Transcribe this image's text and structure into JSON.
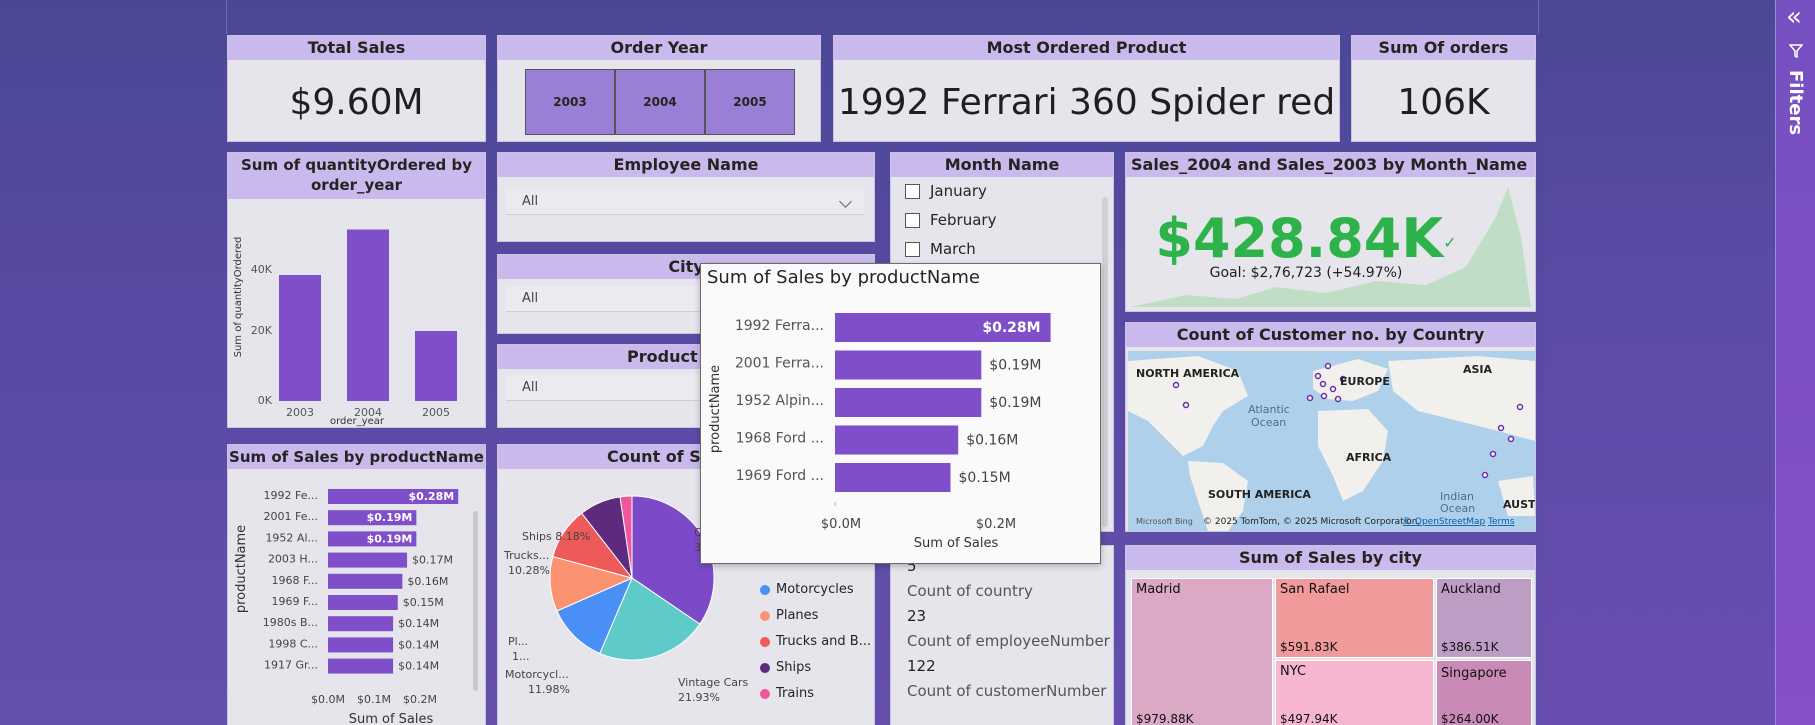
{
  "colors": {
    "bar": "#7f4fc9",
    "accent": "#2db34a",
    "header": "#c9b9ec",
    "tile": "#e6e5ec"
  },
  "kpis": {
    "total_sales": {
      "title": "Total Sales",
      "value": "$9.60M"
    },
    "order_year": {
      "title": "Order Year",
      "years": [
        "2003",
        "2004",
        "2005"
      ]
    },
    "most_ordered": {
      "title": "Most Ordered Product",
      "value": "1992 Ferrari 360 Spider red"
    },
    "sum_orders": {
      "title": "Sum Of orders",
      "value": "106K"
    }
  },
  "qty_chart": {
    "title": "Sum of quantityOrdered by order_year",
    "ylabel": "Sum of quantityOrdered",
    "xlabel": "order_year",
    "yticks": [
      "40K",
      "20K",
      "0K"
    ],
    "chart_data": {
      "type": "bar",
      "categories": [
        "2003",
        "2004",
        "2005"
      ],
      "values": [
        36000,
        49000,
        20000
      ],
      "ylim": [
        0,
        50000
      ],
      "xlabel": "order_year",
      "ylabel": "Sum of quantityOrdered"
    }
  },
  "employee_slicer": {
    "title": "Employee Name",
    "value": "All"
  },
  "city_slicer": {
    "title": "City",
    "value": "All"
  },
  "product_slicer": {
    "title": "Product Type",
    "value": "All"
  },
  "month_slicer": {
    "title": "Month Name",
    "items": [
      "January",
      "February",
      "March"
    ]
  },
  "gauge": {
    "title": "Sales_2004 and Sales_2003 by Month_Name",
    "value": "$428.84K",
    "check": "✓",
    "goal": "Goal: $2,76,723 (+54.97%)"
  },
  "map": {
    "title": "Count of Customer no. by Country",
    "labels": [
      "NORTH AMERICA",
      "EUROPE",
      "ASIA",
      "Atlantic",
      "Ocean",
      "AFRICA",
      "SOUTH AMERICA",
      "Indian",
      "Ocean",
      "AUST"
    ],
    "attribution": "© 2025 TomTom, © 2025 Microsoft Corporation,",
    "osm": "© OpenStreetMap",
    "terms": "Terms",
    "bing": "Microsoft Bing"
  },
  "sales_product": {
    "title": "Sum of Sales by productName",
    "ylabel": "productName",
    "xlabel": "Sum of Sales",
    "xticks": [
      "$0.0M",
      "$0.1M",
      "$0.2M"
    ],
    "labels": [
      "1992 Fe...",
      "2001 Fe...",
      "1952 Al...",
      "2003 H...",
      "1968 F...",
      "1969 F...",
      "1980s B...",
      "1998 C...",
      "1917 Gr..."
    ],
    "value_labels": [
      "$0.28M",
      "$0.19M",
      "$0.19M",
      "$0.17M",
      "$0.16M",
      "$0.15M",
      "$0.14M",
      "$0.14M",
      "$0.14M"
    ],
    "chart_data": {
      "type": "bar",
      "categories": [
        "1992 Fe...",
        "2001 Fe...",
        "1952 Al...",
        "2003 H...",
        "1968 F...",
        "1969 F...",
        "1980s B...",
        "1998 C...",
        "1917 Gr..."
      ],
      "values": [
        0.28,
        0.19,
        0.19,
        0.17,
        0.16,
        0.15,
        0.14,
        0.14,
        0.14
      ],
      "xlim": [
        0,
        0.3
      ]
    }
  },
  "pie": {
    "title": "Count of Sales by",
    "labels": [
      "Ships 8.18%",
      "Trucks...",
      "10.28%",
      "Pl...",
      "1...",
      "Motorcycl...",
      "11.98%",
      "Vintage Cars",
      "21.93%",
      "C...",
      "3..."
    ],
    "legend": [
      {
        "name": "Motorcycles",
        "color": "#4a8ff5"
      },
      {
        "name": "Planes",
        "color": "#fb9272"
      },
      {
        "name": "Trucks and B...",
        "color": "#ee5a5a"
      },
      {
        "name": "Ships",
        "color": "#5e2a7e"
      },
      {
        "name": "Trains",
        "color": "#f0579a"
      }
    ],
    "chart_data": {
      "type": "pie",
      "categories": [
        "Classic Cars",
        "Vintage Cars",
        "Motorcycles",
        "Planes",
        "Trucks and Buses",
        "Ships",
        "Trains"
      ],
      "values": [
        34.5,
        21.93,
        11.98,
        10.8,
        10.28,
        8.18,
        2.33
      ]
    }
  },
  "card_counts": {
    "items": [
      {
        "value": "5",
        "label": "Count of country"
      },
      {
        "value": "23",
        "label": "Count of employeeNumber"
      },
      {
        "value": "122",
        "label": "Count of customerNumber"
      }
    ]
  },
  "treemap": {
    "title": "Sum of Sales by city",
    "cells": [
      {
        "name": "Madrid",
        "value": "$979.88K"
      },
      {
        "name": "San Rafael",
        "value": "$591.83K"
      },
      {
        "name": "Auckland",
        "value": "$386.51K"
      },
      {
        "name": "NYC",
        "value": "$497.94K"
      },
      {
        "name": "Singapore",
        "value": "$264.00K"
      }
    ]
  },
  "tooltip": {
    "title": "Sum of Sales by productName",
    "ylabel": "productName",
    "xlabel": "Sum of Sales",
    "labels": [
      "1992 Ferra...",
      "2001 Ferra...",
      "1952 Alpin...",
      "1968 Ford ...",
      "1969 Ford ..."
    ],
    "value_labels": [
      "$0.28M",
      "$0.19M",
      "$0.19M",
      "$0.16M",
      "$0.15M"
    ],
    "xticks": [
      "$0.0M",
      "$0.2M"
    ],
    "chart_data": {
      "type": "bar",
      "categories": [
        "1992 Ferra...",
        "2001 Ferra...",
        "1952 Alpin...",
        "1968 Ford ...",
        "1969 Ford ..."
      ],
      "values": [
        0.28,
        0.19,
        0.19,
        0.16,
        0.15
      ],
      "xlim": [
        0,
        0.3
      ]
    }
  },
  "filters_pane": {
    "label": "Filters",
    "collapse": "«"
  }
}
